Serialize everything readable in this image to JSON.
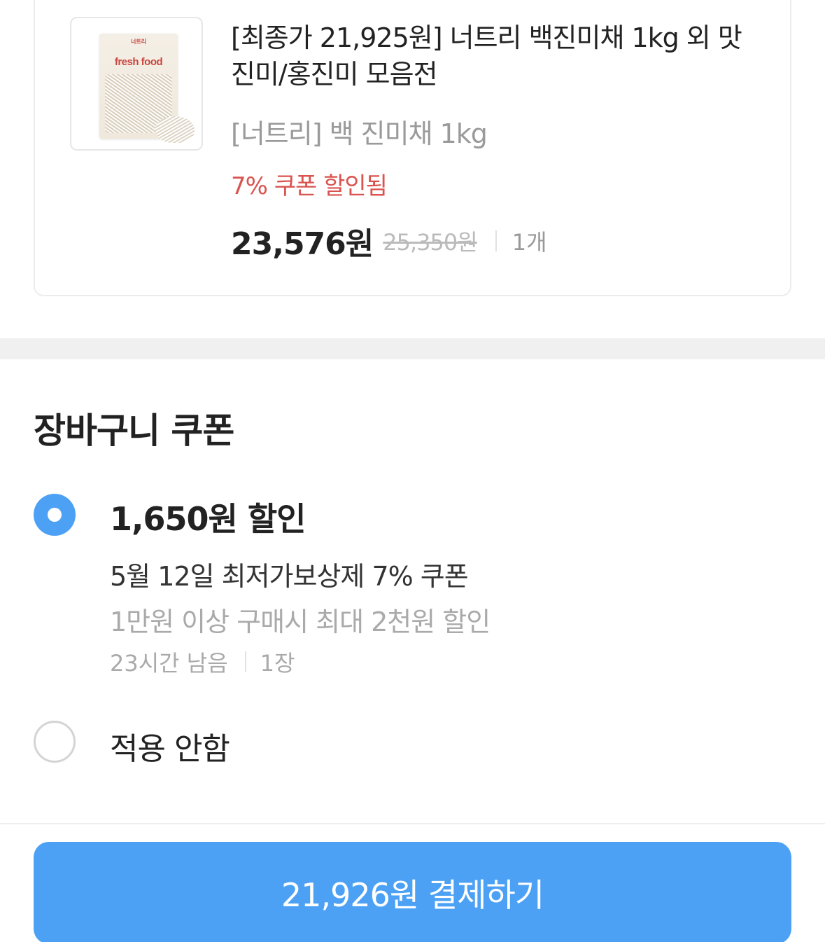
{
  "product": {
    "image_brand": "너트리",
    "image_label": "fresh food",
    "title": "[최종가 21,925원] 너트리 백진미채 1kg 외 맛진미/홍진미 모음전",
    "option": "[너트리] 백 진미채 1kg",
    "coupon_applied": "7% 쿠폰 할인됨",
    "price": "23,576원",
    "original_price": "25,350원",
    "quantity": "1개"
  },
  "cart_coupon": {
    "title": "장바구니 쿠폰",
    "options": [
      {
        "amount": "1,650원 할인",
        "name": "5월 12일 최저가보상제 7% 쿠폰",
        "condition": "1만원 이상 구매시 최대 2천원 할인",
        "remaining": "23시간 남음",
        "count": "1장",
        "selected": true
      },
      {
        "label": "적용 안함",
        "selected": false
      }
    ]
  },
  "pay_button": {
    "label": "21,926원 결제하기"
  },
  "colors": {
    "accent": "#4da1f5",
    "discount": "#d9534f"
  }
}
